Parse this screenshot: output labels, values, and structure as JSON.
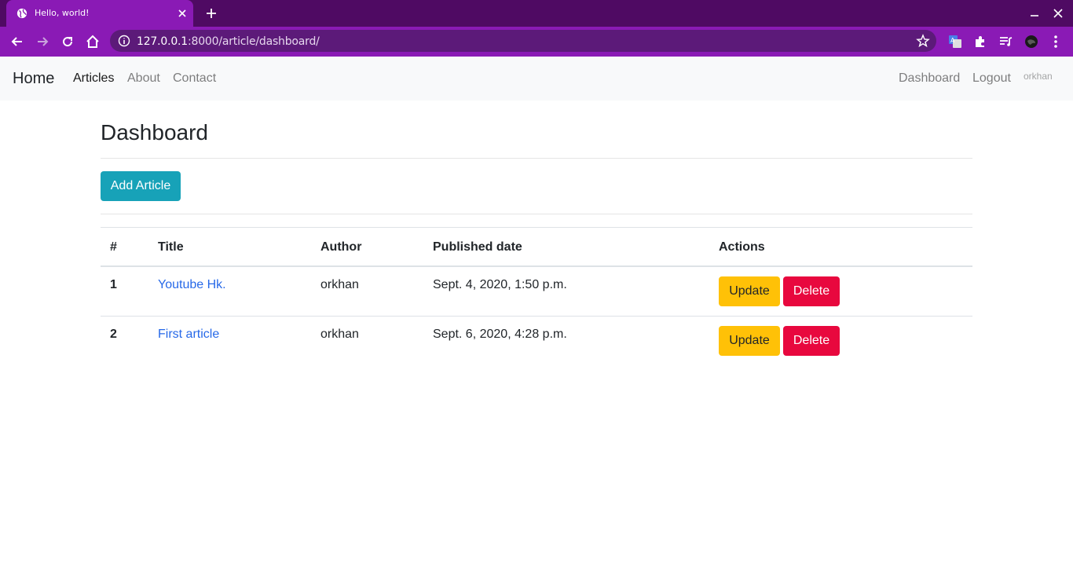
{
  "browser": {
    "tab_title": "Hello, world!",
    "url_host": "127.0.0.1",
    "url_rest": ":8000/article/dashboard/",
    "colors": {
      "tabbar": "#4f0a63",
      "toolbar": "#8a1ab5",
      "omnibox": "#5c1a79"
    }
  },
  "navbar": {
    "brand": "Home",
    "links": [
      {
        "label": "Articles",
        "active": true
      },
      {
        "label": "About",
        "active": false
      },
      {
        "label": "Contact",
        "active": false
      }
    ],
    "right_links": [
      {
        "label": "Dashboard"
      },
      {
        "label": "Logout"
      }
    ],
    "username": "orkhan"
  },
  "page": {
    "title": "Dashboard",
    "add_button": "Add Article",
    "colors": {
      "info": "#17a2b8",
      "warning": "#ffc107",
      "danger": "#e8083e",
      "link": "#2769e8"
    }
  },
  "table": {
    "headers": [
      "#",
      "Title",
      "Author",
      "Published date",
      "Actions"
    ],
    "rows": [
      {
        "num": "1",
        "title": "Youtube Hk.",
        "author": "orkhan",
        "date": "Sept. 4, 2020, 1:50 p.m.",
        "update": "Update",
        "delete": "Delete"
      },
      {
        "num": "2",
        "title": "First article",
        "author": "orkhan",
        "date": "Sept. 6, 2020, 4:28 p.m.",
        "update": "Update",
        "delete": "Delete"
      }
    ]
  }
}
